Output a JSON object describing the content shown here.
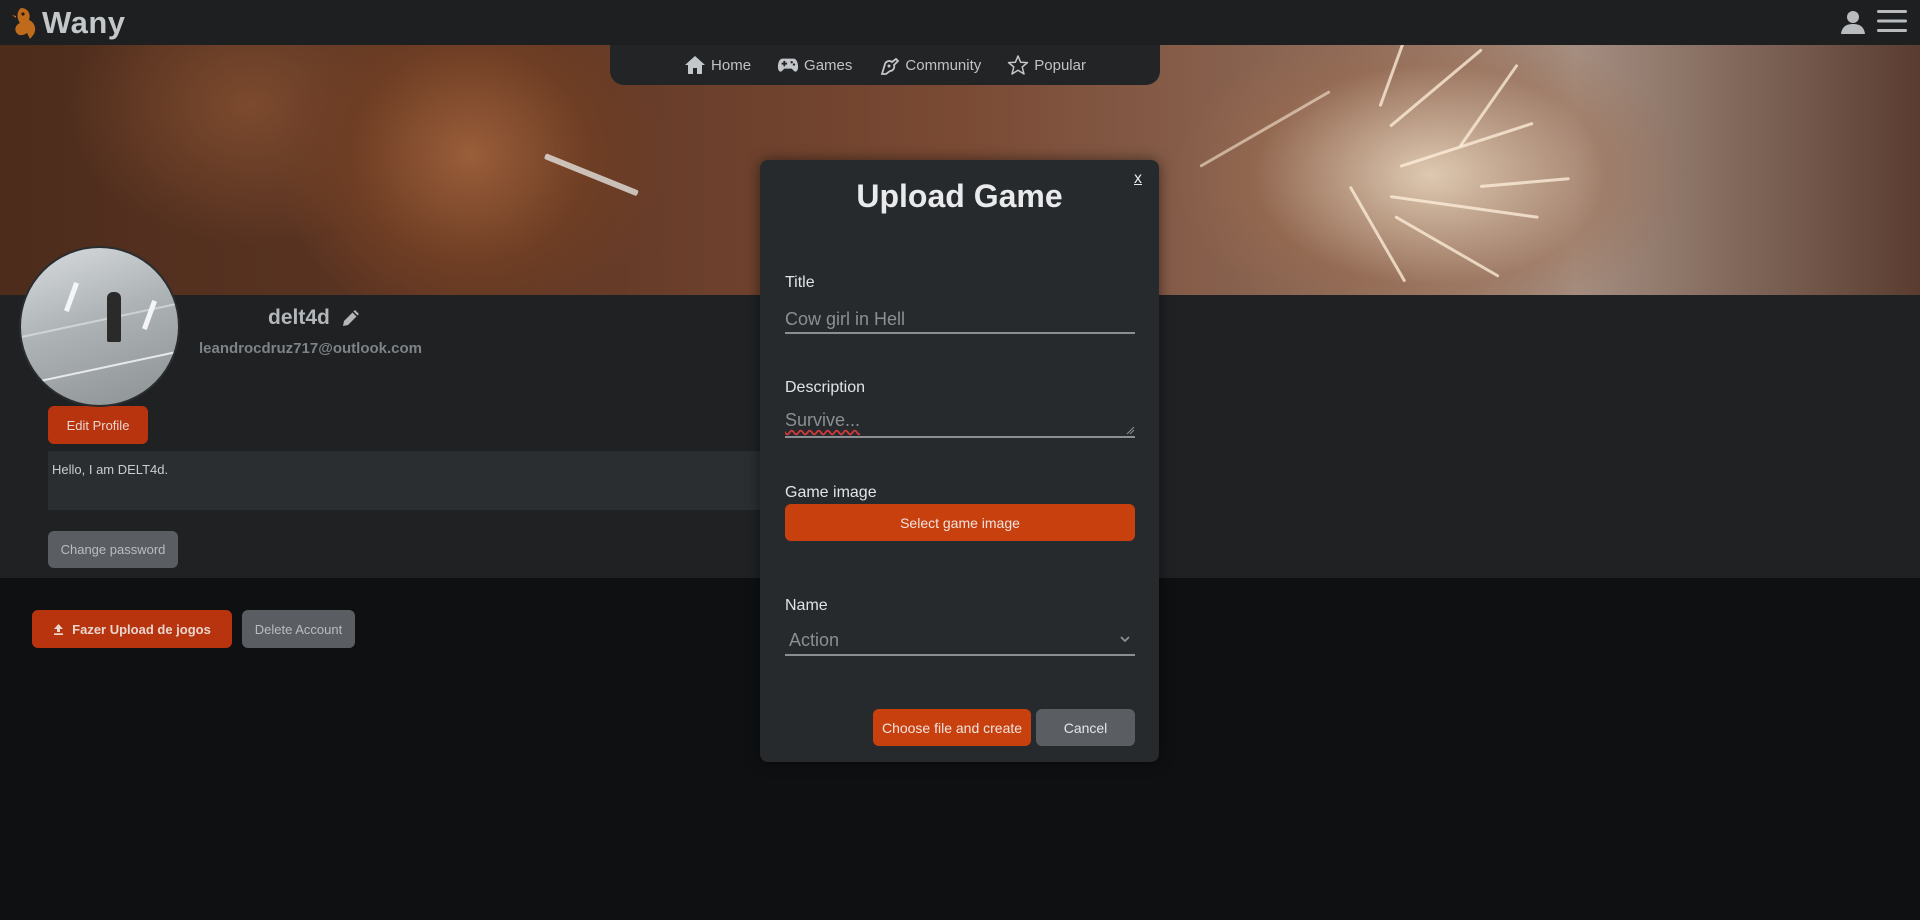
{
  "app": {
    "name": "Wany"
  },
  "nav": {
    "items": [
      {
        "label": "Home",
        "icon": "home-icon"
      },
      {
        "label": "Games",
        "icon": "gamepad-icon"
      },
      {
        "label": "Community",
        "icon": "community-icon"
      },
      {
        "label": "Popular",
        "icon": "star-icon"
      }
    ]
  },
  "profile": {
    "username": "delt4d",
    "email": "leandrocdruz717@outlook.com",
    "edit_profile_label": "Edit Profile",
    "bio": "Hello, I am DELT4d.",
    "change_password_label": "Change password",
    "upload_games_label": "Fazer Upload de jogos",
    "delete_account_label": "Delete Account"
  },
  "modal": {
    "title": "Upload Game",
    "close_label": "x",
    "title_label": "Title",
    "title_value": "Cow girl in Hell",
    "description_label": "Description",
    "description_value": "Survive...",
    "image_label": "Game image",
    "select_image_label": "Select game image",
    "name_label": "Name",
    "name_value": "Action",
    "create_label": "Choose file and create",
    "cancel_label": "Cancel"
  },
  "colors": {
    "accent": "#c9400f",
    "background": "#0e1011",
    "panel": "#1f2123",
    "modal": "#272a2d",
    "grey_button": "#5a5e62"
  }
}
